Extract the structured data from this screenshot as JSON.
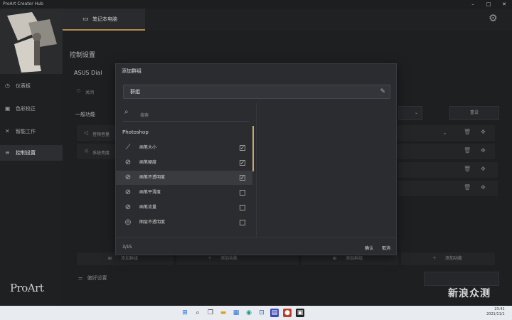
{
  "window": {
    "title": "ProArt Creator Hub"
  },
  "device_tab": {
    "label": "笔记本电脑"
  },
  "sidebar": {
    "items": [
      {
        "label": "仪表板",
        "icon": "clock-icon"
      },
      {
        "label": "色彩校正",
        "icon": "palette-icon"
      },
      {
        "label": "智能工作",
        "icon": "tools-icon"
      },
      {
        "label": "控制设置",
        "icon": "equalizer-icon",
        "active": true
      }
    ],
    "logo": "ProArt"
  },
  "main": {
    "title": "控制设置",
    "subtab": "ASUS Dial",
    "toggle_label": "关闭",
    "section_label": "一般功能",
    "rows": [
      "音频音量",
      "系统亮度"
    ],
    "reset_label": "重设",
    "add_group": "添加群组",
    "add_function": "添加功能",
    "preferences": "偏好设置"
  },
  "dialog": {
    "title": "添加群组",
    "name_value": "群组",
    "search_placeholder": "搜索",
    "section": "Photoshop",
    "items": [
      {
        "label": "画笔大小",
        "checked": true,
        "icon": "brush-size-icon"
      },
      {
        "label": "画笔硬度",
        "checked": true,
        "icon": "brush-hardness-icon"
      },
      {
        "label": "画笔不透明度",
        "checked": true,
        "icon": "brush-opacity-icon"
      },
      {
        "label": "画笔平滑度",
        "checked": false,
        "icon": "brush-smooth-icon"
      },
      {
        "label": "画笔流量",
        "checked": false,
        "icon": "brush-flow-icon"
      },
      {
        "label": "图层不透明度",
        "checked": false,
        "icon": "layer-opacity-icon"
      }
    ],
    "count": "3/15",
    "confirm": "确认",
    "cancel": "取消"
  },
  "taskbar": {
    "time": "23:41",
    "date": "2021/11/1"
  },
  "watermark": "新浪众测",
  "colors": {
    "accent": "#c9a66b",
    "background": "#232426",
    "dialog": "#2b2c2f"
  }
}
